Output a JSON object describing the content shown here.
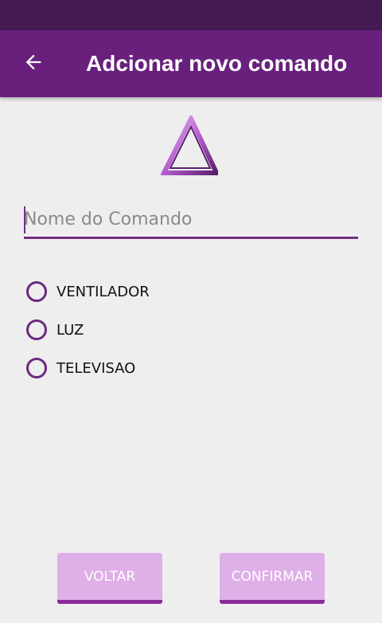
{
  "app_bar": {
    "title": "Adcionar novo comando",
    "back_icon": "arrow-left-icon"
  },
  "logo_icon": "triangle-icon",
  "form": {
    "name_placeholder": "Nome do Comando",
    "name_value": ""
  },
  "device_options": [
    {
      "label": "VENTILADOR",
      "selected": false
    },
    {
      "label": "LUZ",
      "selected": false
    },
    {
      "label": "TELEVISAO",
      "selected": false
    }
  ],
  "buttons": {
    "back_label": "VOLTAR",
    "confirm_label": "CONFIRMAR"
  },
  "colors": {
    "status_bar": "#431a52",
    "app_bar": "#69207d",
    "accent": "#742d86",
    "button_bg": "#dfafe8",
    "button_border": "#8a2b9c",
    "background": "#eeeeee"
  }
}
